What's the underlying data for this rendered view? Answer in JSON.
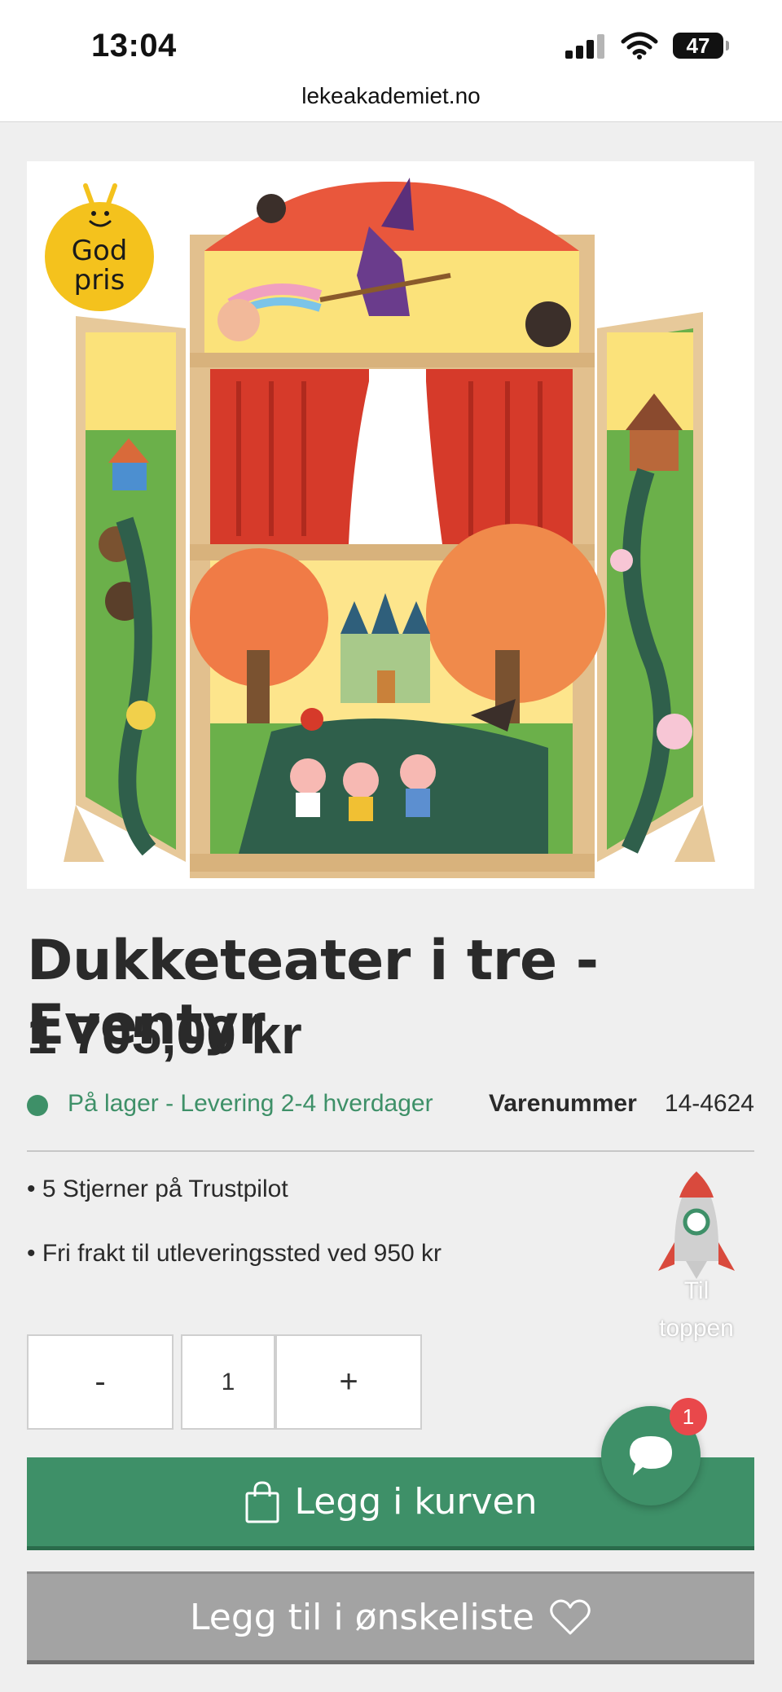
{
  "status_bar": {
    "time": "13:04",
    "battery": "47"
  },
  "browser": {
    "url": "lekeakademiet.no"
  },
  "product": {
    "badge_line1": "God",
    "badge_line2": "pris",
    "title": "Dukketeater i tre - Eventyr",
    "price": "1 705,00 kr",
    "stock_text": "På lager - Levering 2-4 hverdager",
    "sku_label": "Varenummer",
    "sku_value": "14-4624"
  },
  "usps": [
    "• 5 Stjerner på Trustpilot",
    "• Fri frakt til utleveringssted ved 950 kr"
  ],
  "back_to_top": {
    "line1": "Til",
    "line2": "toppen"
  },
  "quantity": {
    "minus": "-",
    "value": "1",
    "plus": "+"
  },
  "buttons": {
    "add_to_cart": "Legg i kurven",
    "wishlist": "Legg til i ønskeliste"
  },
  "chat": {
    "badge_count": "1"
  },
  "colors": {
    "accent_green": "#3e9068",
    "badge_yellow": "#f4c21d",
    "wishlist_gray": "#a3a3a3",
    "notification_red": "#e9484b"
  },
  "icons": [
    "signal-icon",
    "wifi-icon",
    "battery-icon",
    "shopping-bag-icon",
    "heart-icon",
    "chat-bubble-icon",
    "rocket-icon"
  ]
}
